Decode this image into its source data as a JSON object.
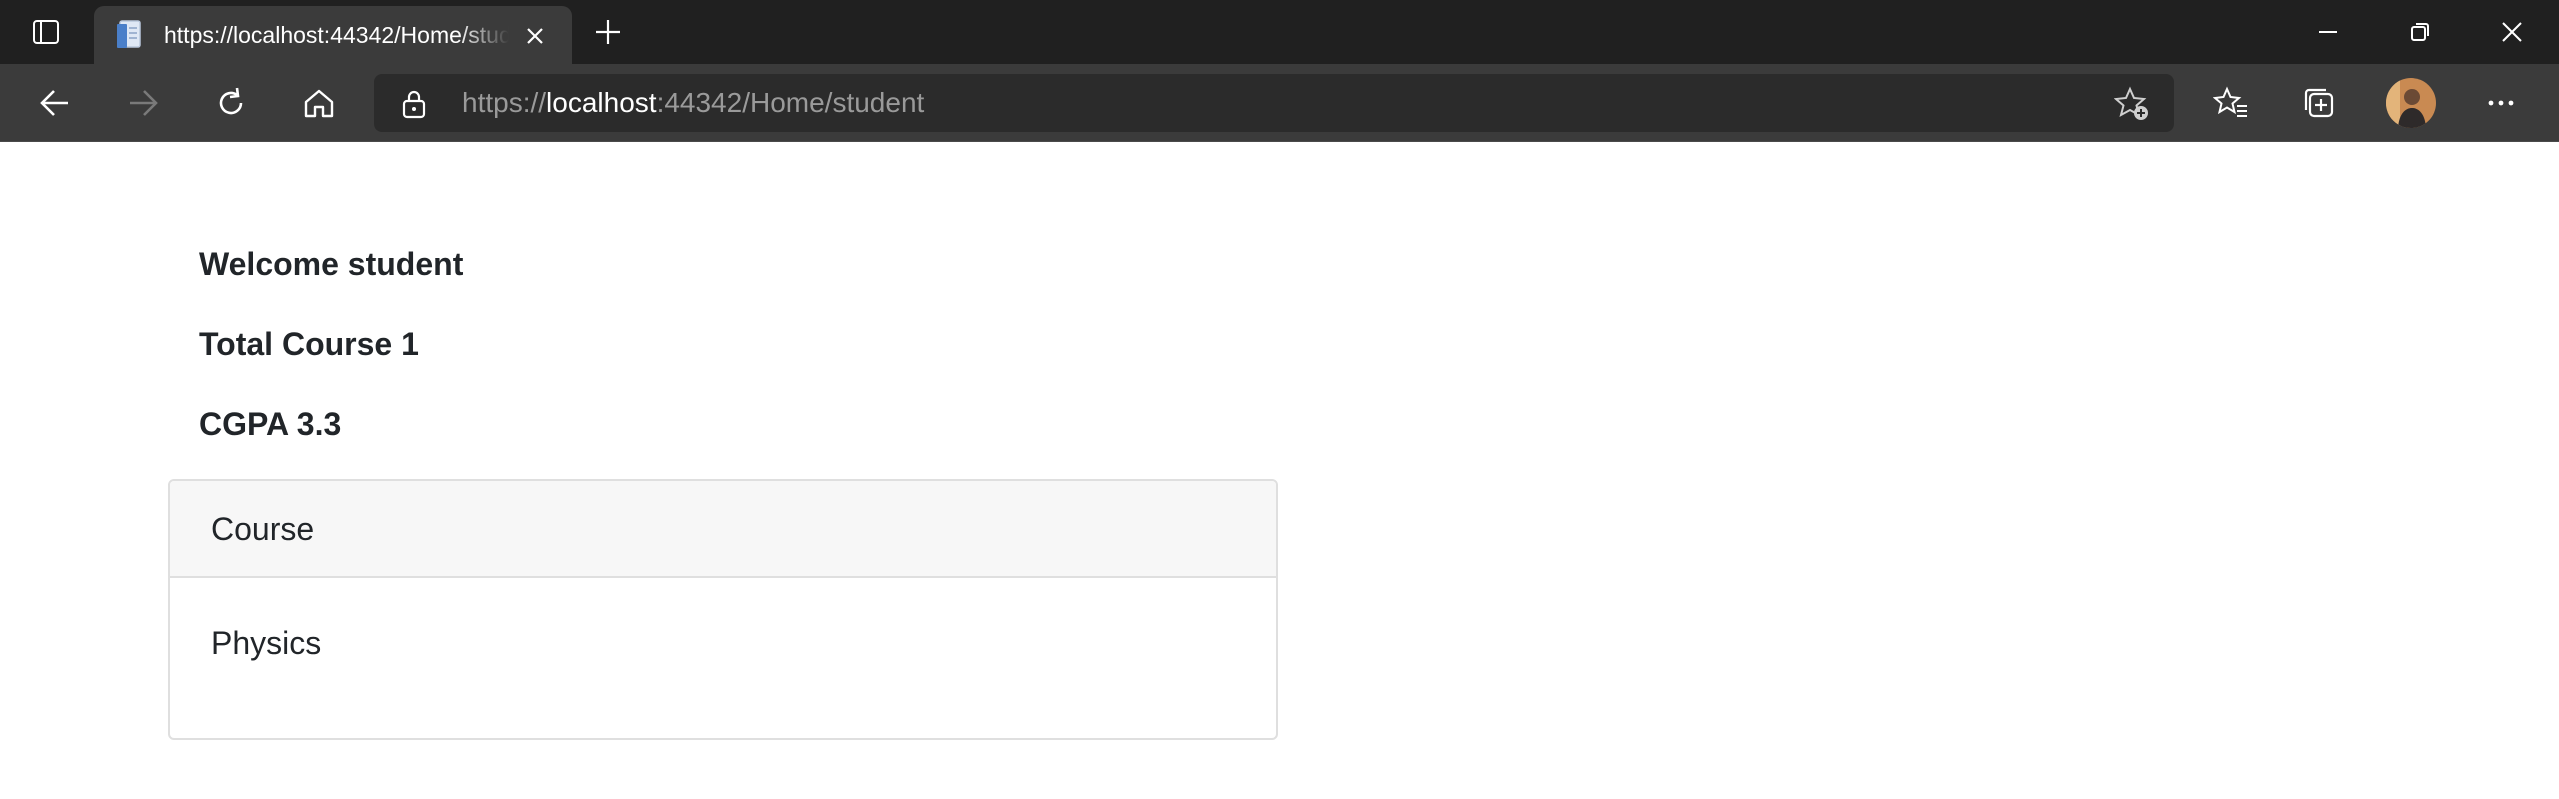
{
  "browser": {
    "tab": {
      "title": "https://localhost:44342/Home/student"
    },
    "address": {
      "scheme": "https://",
      "host": "localhost",
      "rest": ":44342/Home/student"
    }
  },
  "page": {
    "welcome": "Welcome student",
    "total_course": "Total Course 1",
    "cgpa": "CGPA 3.3",
    "table": {
      "header": "Course",
      "rows": [
        "Physics"
      ]
    }
  },
  "icons": {
    "tab_actions": "tab-actions-icon",
    "favicon": "page-favicon-icon",
    "close": "close-icon",
    "new_tab": "plus-icon",
    "minimize": "minimize-icon",
    "restore": "restore-icon",
    "window_close": "close-icon",
    "back": "back-arrow-icon",
    "forward": "forward-arrow-icon",
    "refresh": "refresh-icon",
    "home": "home-icon",
    "lock": "lock-icon",
    "add_favorite": "star-plus-icon",
    "favorites": "favorites-icon",
    "collections": "collections-icon",
    "menu": "more-icon"
  },
  "colors": {
    "tabstrip_bg": "#202020",
    "toolbar_bg": "#3b3b3b",
    "addressbar_bg": "#2b2b2b",
    "card_header_bg": "#f7f7f7",
    "text": "#212529"
  }
}
